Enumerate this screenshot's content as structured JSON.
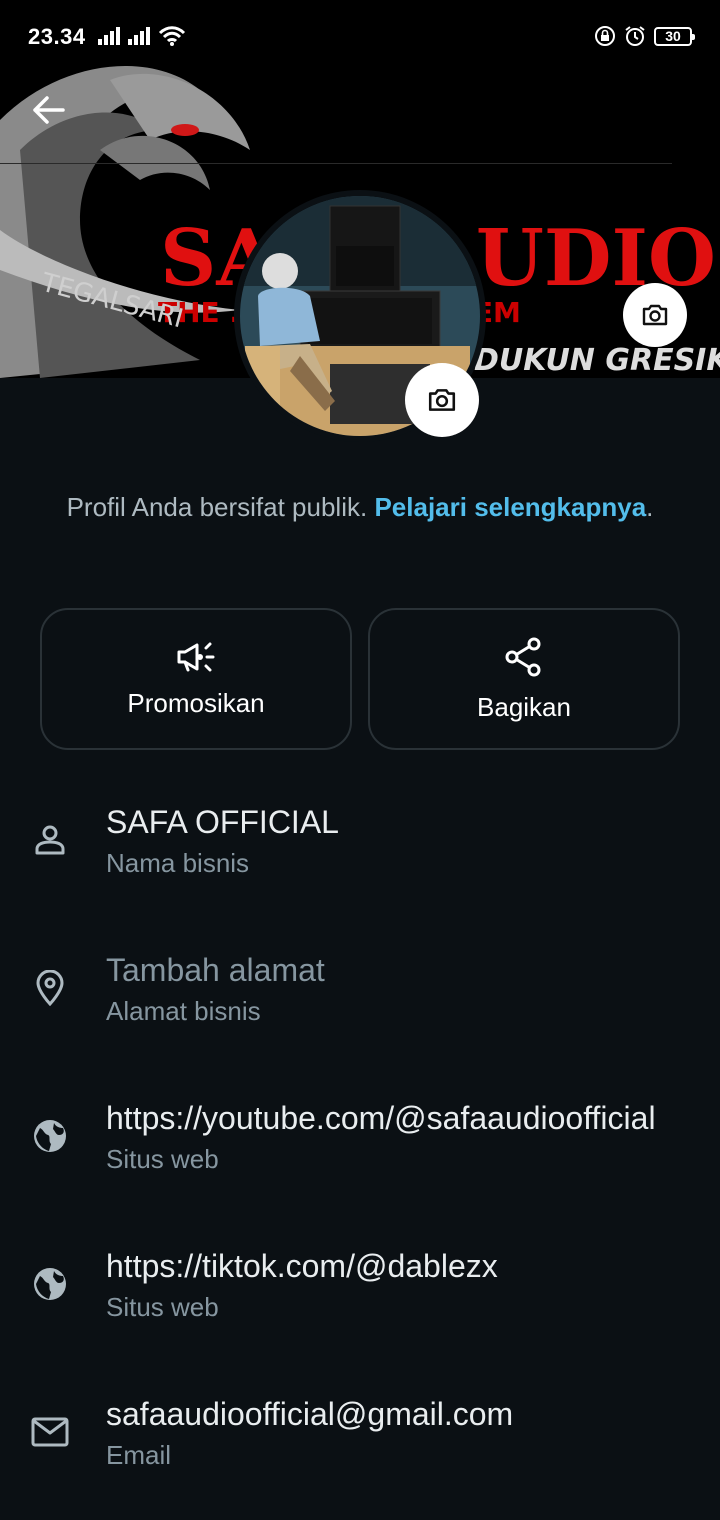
{
  "status_bar": {
    "time": "23.34",
    "battery": "30"
  },
  "cover": {
    "logo_text": "SAFA AUDIO",
    "tagline": "THE ... SOUND SYSTEM",
    "left_text": "TEGALSARI",
    "right_text": "DUKUN GRESIK"
  },
  "public_note": {
    "text": "Profil Anda bersifat publik.",
    "link": "Pelajari selengkapnya",
    "suffix": "."
  },
  "actions": [
    {
      "label": "Promosikan",
      "icon": "megaphone-icon"
    },
    {
      "label": "Bagikan",
      "icon": "share-icon"
    }
  ],
  "info": [
    {
      "value": "SAFA OFFICIAL",
      "label": "Nama bisnis",
      "icon": "person-icon"
    },
    {
      "value": "Tambah alamat",
      "label": "Alamat bisnis",
      "icon": "location-pin-icon"
    },
    {
      "value": "https://youtube.com/@safaaudioofficial",
      "label": "Situs web",
      "icon": "globe-icon"
    },
    {
      "value": "https://tiktok.com/@dablezx",
      "label": "Situs web",
      "icon": "globe-icon"
    },
    {
      "value": "safaaudioofficial@gmail.com",
      "label": "Email",
      "icon": "mail-icon"
    }
  ]
}
